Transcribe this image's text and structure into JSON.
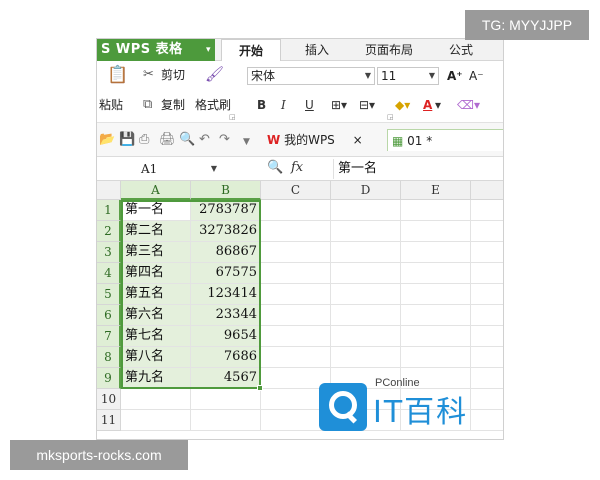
{
  "app": {
    "button_label": "S WPS 表格",
    "dropdown_glyph": "▾"
  },
  "ribbon_tabs": [
    {
      "label": "开始",
      "active": true
    },
    {
      "label": "插入",
      "active": false
    },
    {
      "label": "页面布局",
      "active": false
    },
    {
      "label": "公式",
      "active": false
    }
  ],
  "clipboard": {
    "paste_label": "粘贴",
    "cut_label": "剪切",
    "copy_label": "复制",
    "format_painter_label": "格式刷"
  },
  "font": {
    "family": "宋体",
    "size": "11",
    "grow_label": "A⁺",
    "shrink_label": "A⁻",
    "bold_label": "B",
    "italic_label": "I",
    "underline_label": "U",
    "font_color_label": "A"
  },
  "doc_tabs": [
    {
      "label": "我的WPS",
      "active": false,
      "close": "×"
    },
    {
      "label": "01 *",
      "active": true
    }
  ],
  "formula_bar": {
    "name_box": "A1",
    "fx_label": "fx",
    "content": "第一名"
  },
  "columns": [
    "A",
    "B",
    "C",
    "D",
    "E"
  ],
  "rows": [
    {
      "num": "1",
      "a": "第一名",
      "b": "2783787"
    },
    {
      "num": "2",
      "a": "第二名",
      "b": "3273826"
    },
    {
      "num": "3",
      "a": "第三名",
      "b": "86867"
    },
    {
      "num": "4",
      "a": "第四名",
      "b": "67575"
    },
    {
      "num": "5",
      "a": "第五名",
      "b": "123414"
    },
    {
      "num": "6",
      "a": "第六名",
      "b": "23344"
    },
    {
      "num": "7",
      "a": "第七名",
      "b": "9654"
    },
    {
      "num": "8",
      "a": "第八名",
      "b": "7686"
    },
    {
      "num": "9",
      "a": "第九名",
      "b": "4567"
    },
    {
      "num": "10",
      "a": "",
      "b": ""
    },
    {
      "num": "11",
      "a": "",
      "b": ""
    }
  ],
  "logo": {
    "brand": "PConline",
    "name": "IT百科"
  },
  "overlays": {
    "telegram": "TG: MYYJJPP",
    "site": "mksports-rocks.com"
  },
  "colors": {
    "wps_green": "#4d9a3c",
    "selection_fill": "#e4f0dc",
    "logo_blue": "#1f8fd8"
  }
}
